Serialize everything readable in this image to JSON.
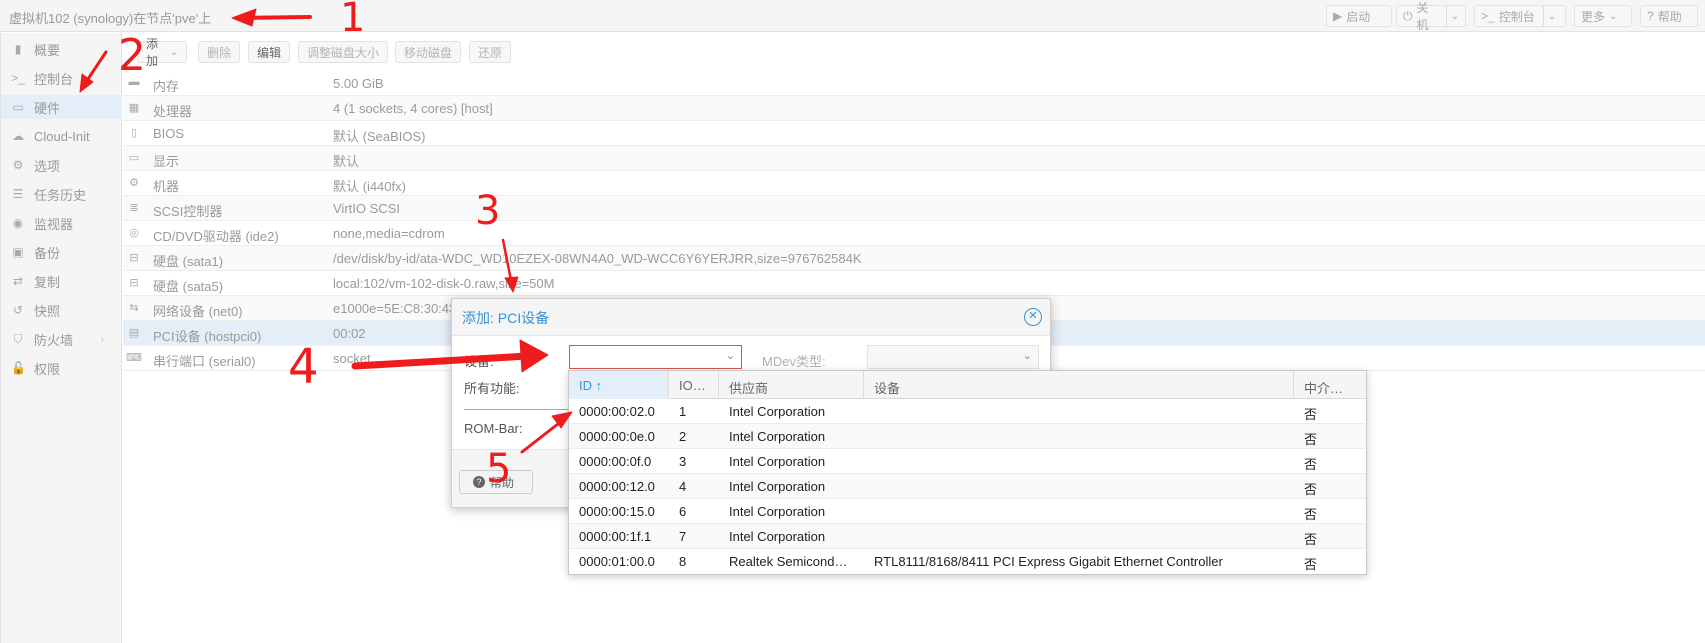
{
  "header": {
    "title": "虚拟机102 (synology)在节点'pve'上",
    "buttons": {
      "start": "启动",
      "shutdown": "关机",
      "console": "控制台",
      "more": "更多",
      "help": "帮助"
    }
  },
  "sidebar": {
    "items": [
      {
        "label": "概要",
        "icon": "book-icon"
      },
      {
        "label": "控制台",
        "icon": "terminal-icon"
      },
      {
        "label": "硬件",
        "icon": "monitor-icon"
      },
      {
        "label": "Cloud-Init",
        "icon": "cloud-icon"
      },
      {
        "label": "选项",
        "icon": "gear-icon"
      },
      {
        "label": "任务历史",
        "icon": "list-icon"
      },
      {
        "label": "监视器",
        "icon": "eye-icon"
      },
      {
        "label": "备份",
        "icon": "floppy-icon"
      },
      {
        "label": "复制",
        "icon": "retweet-icon"
      },
      {
        "label": "快照",
        "icon": "history-icon"
      },
      {
        "label": "防火墙",
        "icon": "shield-icon"
      },
      {
        "label": "权限",
        "icon": "unlock-icon"
      }
    ]
  },
  "toolbar": {
    "add": "添加",
    "remove": "删除",
    "edit": "编辑",
    "resize": "调整磁盘大小",
    "move": "移动磁盘",
    "revert": "还原"
  },
  "hardware": [
    {
      "key": "内存",
      "value": "5.00 GiB",
      "icon": "memory-icon"
    },
    {
      "key": "处理器",
      "value": "4 (1 sockets, 4 cores) [host]",
      "icon": "cpu-icon"
    },
    {
      "key": "BIOS",
      "value": "默认 (SeaBIOS)",
      "icon": "microchip-icon"
    },
    {
      "key": "显示",
      "value": "默认",
      "icon": "desktop-icon"
    },
    {
      "key": "机器",
      "value": "默认 (i440fx)",
      "icon": "cogs-icon"
    },
    {
      "key": "SCSI控制器",
      "value": "VirtIO SCSI",
      "icon": "database-icon"
    },
    {
      "key": "CD/DVD驱动器 (ide2)",
      "value": "none,media=cdrom",
      "icon": "disc-icon"
    },
    {
      "key": "硬盘 (sata1)",
      "value": "/dev/disk/by-id/ata-WDC_WD10EZEX-08WN4A0_WD-WCC6Y6YERJRR,size=976762584K",
      "icon": "hdd-icon"
    },
    {
      "key": "硬盘 (sata5)",
      "value": "local:102/vm-102-disk-0.raw,size=50M",
      "icon": "hdd-icon"
    },
    {
      "key": "网络设备 (net0)",
      "value": "e1000e=5E:C8:30:43",
      "icon": "exchange-icon"
    },
    {
      "key": "PCI设备 (hostpci0)",
      "value": "00:02",
      "icon": "pci-card-icon"
    },
    {
      "key": "串行端口 (serial0)",
      "value": "socket",
      "icon": "keyboard-icon"
    }
  ],
  "dialog": {
    "title": "添加: PCI设备",
    "device_label": "设备:",
    "mdev_label": "MDev类型:",
    "all_functions_label": "所有功能:",
    "rombar_label": "ROM-Bar:",
    "help": "帮助"
  },
  "pci_grid": {
    "columns": [
      "ID ↑",
      "IO…",
      "供应商",
      "设备",
      "中介…"
    ],
    "rows": [
      {
        "id": "0000:00:02.0",
        "io": "1",
        "vendor": "Intel Corporation",
        "device": "",
        "mediated": "否"
      },
      {
        "id": "0000:00:0e.0",
        "io": "2",
        "vendor": "Intel Corporation",
        "device": "",
        "mediated": "否"
      },
      {
        "id": "0000:00:0f.0",
        "io": "3",
        "vendor": "Intel Corporation",
        "device": "",
        "mediated": "否"
      },
      {
        "id": "0000:00:12.0",
        "io": "4",
        "vendor": "Intel Corporation",
        "device": "",
        "mediated": "否"
      },
      {
        "id": "0000:00:15.0",
        "io": "6",
        "vendor": "Intel Corporation",
        "device": "",
        "mediated": "否"
      },
      {
        "id": "0000:00:1f.1",
        "io": "7",
        "vendor": "Intel Corporation",
        "device": "",
        "mediated": "否"
      },
      {
        "id": "0000:01:00.0",
        "io": "8",
        "vendor": "Realtek Semicond…",
        "device": "RTL8111/8168/8411 PCI Express Gigabit Ethernet Controller",
        "mediated": "否"
      }
    ]
  },
  "annotations": {
    "color": "#ee1c1c",
    "numbers": [
      "1",
      "2",
      "3",
      "4",
      "5"
    ]
  }
}
